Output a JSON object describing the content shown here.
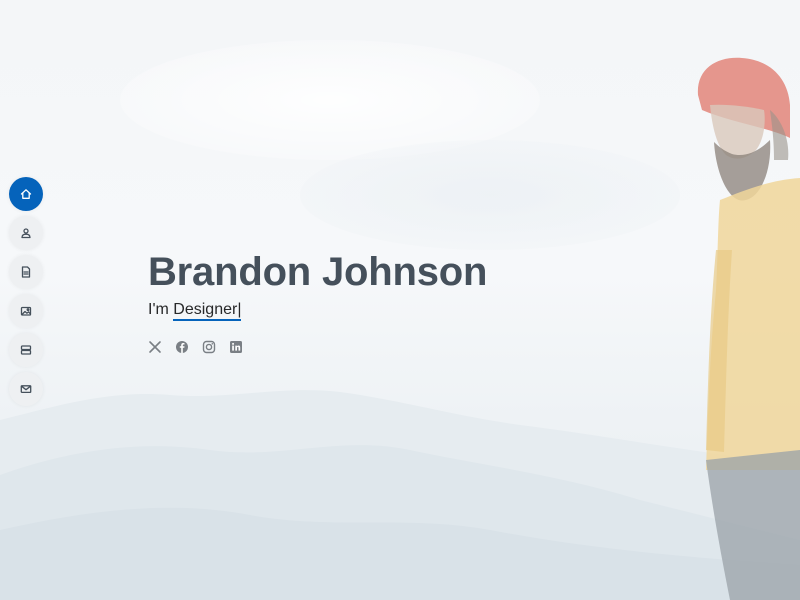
{
  "hero": {
    "name": "Brandon Johnson",
    "tagline_prefix": "I'm",
    "typed_word": "Designer",
    "cursor": "|"
  },
  "nav": {
    "items": [
      {
        "icon": "home-icon",
        "active": true
      },
      {
        "icon": "person-icon",
        "active": false
      },
      {
        "icon": "file-icon",
        "active": false
      },
      {
        "icon": "images-icon",
        "active": false
      },
      {
        "icon": "server-icon",
        "active": false
      },
      {
        "icon": "envelope-icon",
        "active": false
      }
    ]
  },
  "social": [
    {
      "icon": "x-twitter-icon"
    },
    {
      "icon": "facebook-icon"
    },
    {
      "icon": "instagram-icon"
    },
    {
      "icon": "linkedin-icon"
    }
  ],
  "colors": {
    "accent": "#0563bb",
    "heading": "#45505b",
    "text": "#272829",
    "nav_bg": "#eef0f2",
    "social_icon": "#7a7f85"
  }
}
